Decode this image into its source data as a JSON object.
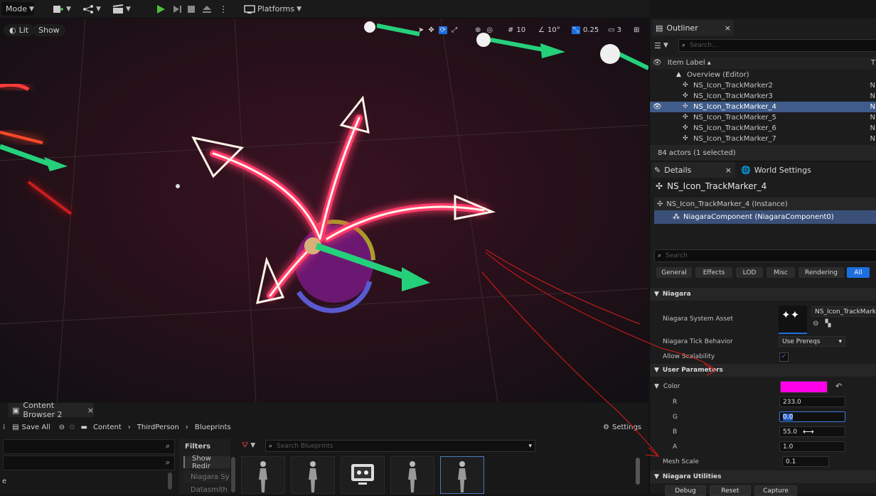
{
  "toolbar": {
    "mode_label": "Mode",
    "platforms_label": "Platforms"
  },
  "viewport": {
    "lit_label": "Lit",
    "show_label": "Show",
    "grid_snap": "10",
    "rotate_snap": "10°",
    "scale_snap": "0.25",
    "camera_speed": "3"
  },
  "outliner": {
    "tab_label": "Outliner",
    "search_placeholder": "Search...",
    "column_label": "Item Label ▴",
    "column_type_label": "T",
    "root_label": "Overview (Editor)",
    "items": [
      {
        "label": "NS_Icon_TrackMarker2",
        "type": "N"
      },
      {
        "label": "NS_Icon_TrackMarker3",
        "type": "N"
      },
      {
        "label": "NS_Icon_TrackMarker_4",
        "type": "N"
      },
      {
        "label": "NS_Icon_TrackMarker_5",
        "type": "N"
      },
      {
        "label": "NS_Icon_TrackMarker_6",
        "type": "N"
      },
      {
        "label": "NS_Icon_TrackMarker_7",
        "type": "N"
      }
    ],
    "footer": "84 actors (1 selected)"
  },
  "details": {
    "tab_label": "Details",
    "world_settings_label": "World Settings",
    "object_name": "NS_Icon_TrackMarker_4",
    "component_root": "NS_Icon_TrackMarker_4 (Instance)",
    "component_child": "NiagaraComponent (NiagaraComponent0)",
    "search_placeholder": "Search",
    "filter_tabs": [
      "General",
      "Effects",
      "LOD",
      "Misc",
      "Rendering",
      "All"
    ],
    "niagara_category": "Niagara",
    "system_asset_label": "Niagara System Asset",
    "system_asset_value": "NS_Icon_TrackMarker_",
    "tick_behavior_label": "Niagara Tick Behavior",
    "tick_behavior_value": "Use Prereqs",
    "allow_scalability_label": "Allow Scalability",
    "user_params_category": "User Parameters",
    "color_label": "Color",
    "color_swatch": "#ff00e9",
    "r_label": "R",
    "r_value": "233.0",
    "g_label": "G",
    "g_value": "0.0",
    "b_label": "B",
    "b_value": "55.0",
    "a_label": "A",
    "a_value": "1.0",
    "mesh_scale_label": "Mesh Scale",
    "mesh_scale_value": "0.1",
    "utilities_category": "Niagara Utilities",
    "debug_label": "Debug",
    "reset_label": "Reset",
    "capture_label": "Capture"
  },
  "content_browser": {
    "tab_label": "Content Browser 2",
    "save_all_label": "Save All",
    "breadcrumb": [
      "Content",
      "ThirdPerson",
      "Blueprints"
    ],
    "settings_label": "Settings",
    "filters_label": "Filters",
    "filter_items": [
      "Show Redir",
      "Niagara Sy",
      "Datasmith"
    ],
    "search_placeholder": "Search Blueprints",
    "left_text": "e"
  },
  "accent_color": "#1d6fe0"
}
